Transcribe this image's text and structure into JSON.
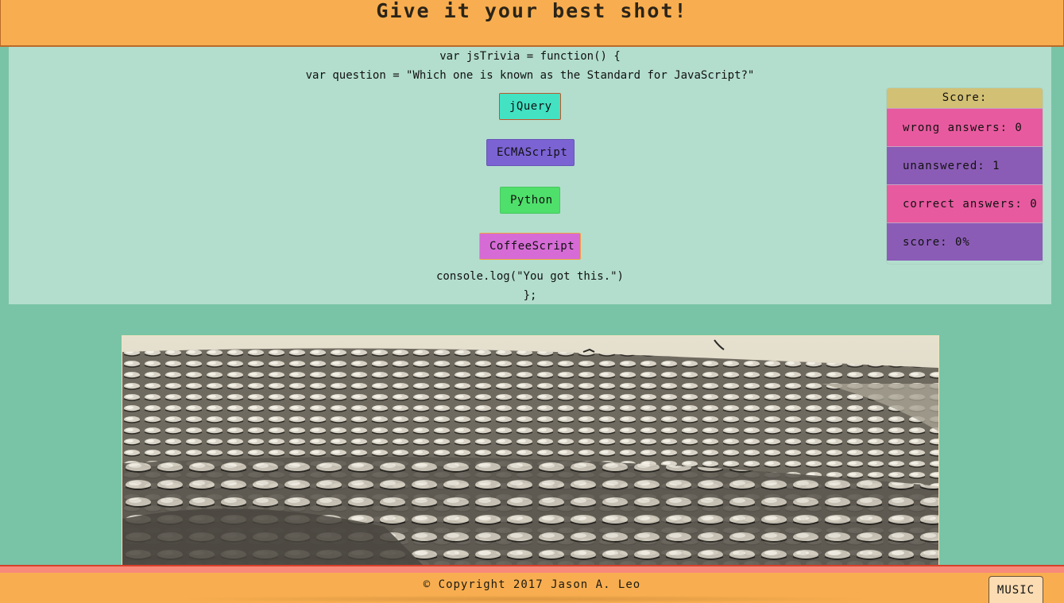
{
  "header": {
    "title": "Give it your best shot!"
  },
  "quiz": {
    "code_open": "var jsTrivia = function() {",
    "question_line": "var question = \"Which one is known as the Standard for JavaScript?\"",
    "answers": [
      "jQuery",
      "ECMAScript",
      "Python",
      "CoffeeScript"
    ],
    "code_log": "console.log(\"You got this.\")",
    "code_close": "};"
  },
  "score": {
    "header": "Score:",
    "wrong": "wrong answers: 0",
    "unanswered": "unanswered: 1",
    "correct": "correct answers: 0",
    "percent": "score: 0%"
  },
  "footer": {
    "copyright": "© Copyright 2017 Jason A. Leo",
    "music_label": "MUSIC"
  },
  "colors": {
    "page_bg": "#79c4a6",
    "header_bg": "#f8ae50",
    "panel_bg": "#b3dece",
    "score_header": "#d2c074",
    "score_pink": "#e85a9f",
    "score_purple": "#8b5cb6"
  }
}
